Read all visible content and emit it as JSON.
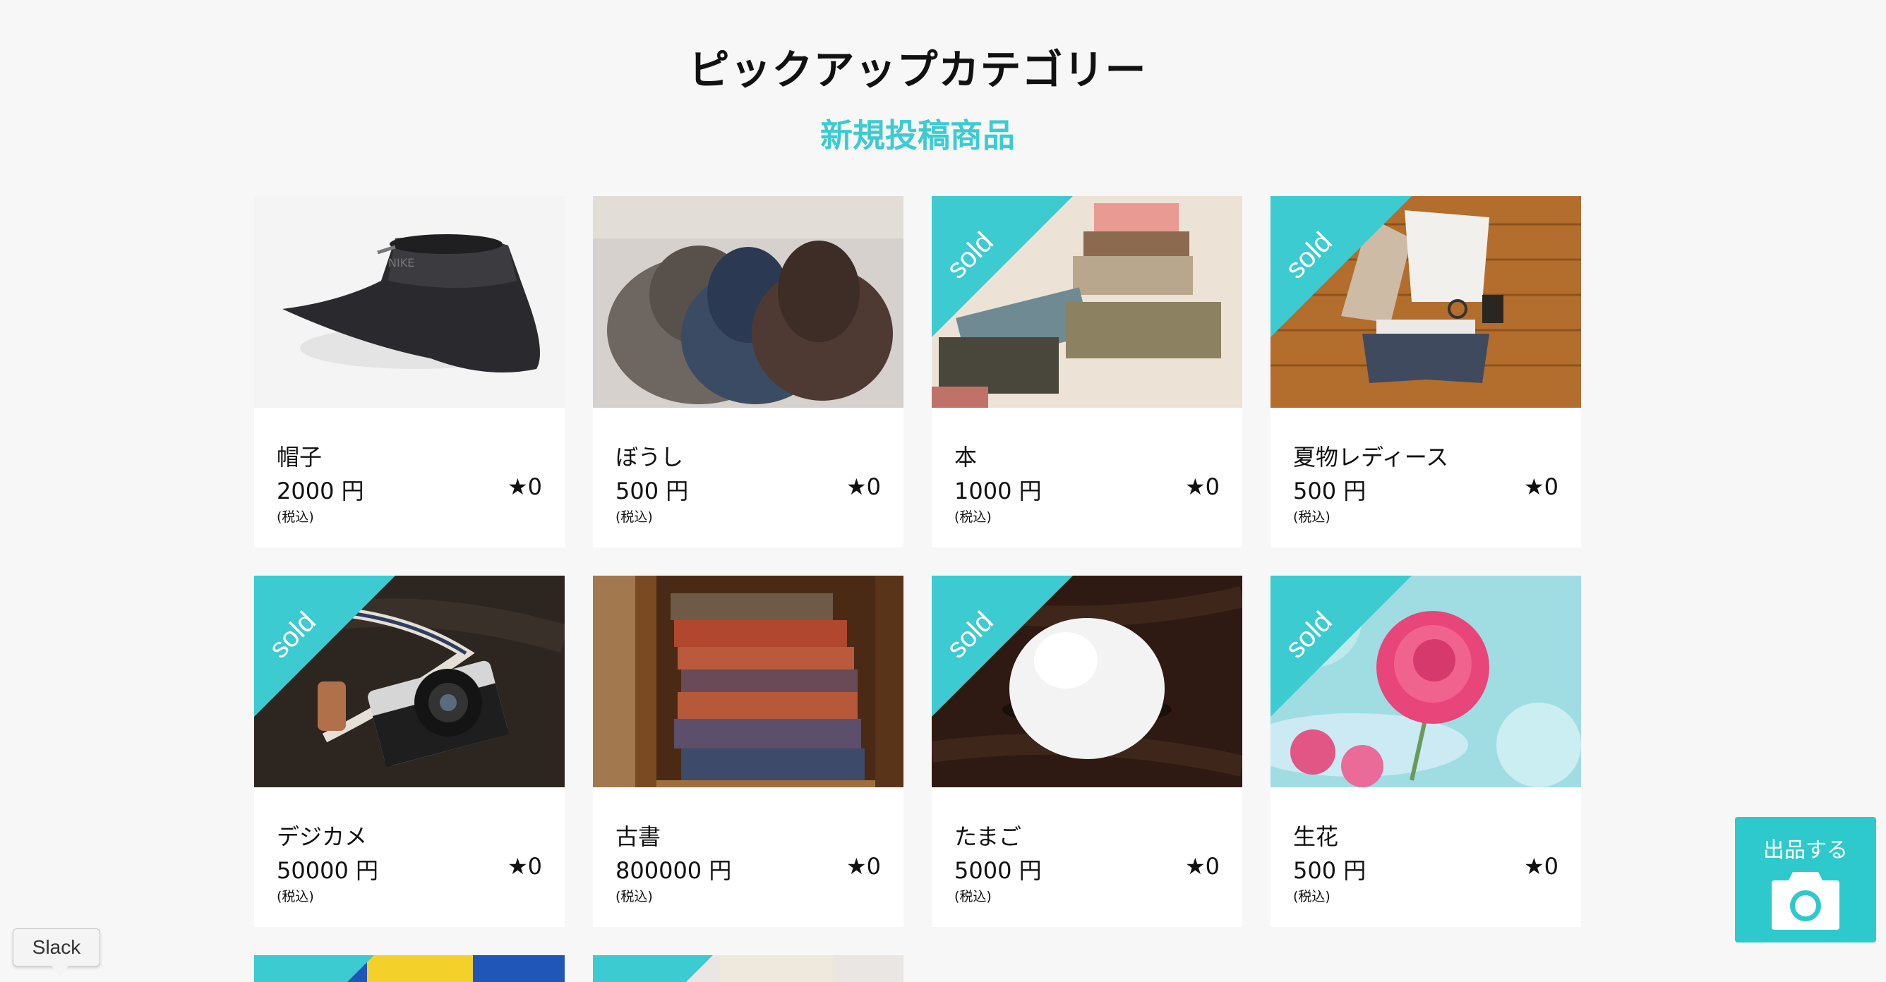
{
  "header": {
    "title": "ピックアップカテゴリー",
    "section_title": "新規投稿商品"
  },
  "products": [
    {
      "name": "帽子",
      "price": "2000 円",
      "tax": "(税込)",
      "likes": "★0",
      "sold": false,
      "image": "black-bucket-hat"
    },
    {
      "name": "ぼうし",
      "price": "500 円",
      "tax": "(税込)",
      "likes": "★0",
      "sold": false,
      "image": "stacked-fedora-hats"
    },
    {
      "name": "本",
      "price": "1000 円",
      "tax": "(税込)",
      "likes": "★0",
      "sold": true,
      "image": "antique-books-pile"
    },
    {
      "name": "夏物レディース",
      "price": "500 円",
      "tax": "(税込)",
      "likes": "★0",
      "sold": true,
      "image": "summer-outfit-on-wood"
    },
    {
      "name": "デジカメ",
      "price": "50000 円",
      "tax": "(税込)",
      "likes": "★0",
      "sold": true,
      "image": "film-camera-with-strap"
    },
    {
      "name": "古書",
      "price": "800000 円",
      "tax": "(税込)",
      "likes": "★0",
      "sold": false,
      "image": "old-book-stack"
    },
    {
      "name": "たまご",
      "price": "5000 円",
      "tax": "(税込)",
      "likes": "★0",
      "sold": true,
      "image": "white-egg-on-wood"
    },
    {
      "name": "生花",
      "price": "500 円",
      "tax": "(税込)",
      "likes": "★0",
      "sold": true,
      "image": "pink-ranunculus-flower"
    }
  ],
  "sold_label": "sold",
  "sell_button": {
    "label": "出品する",
    "icon": "camera-icon"
  },
  "tooltip": {
    "label": "Slack"
  },
  "colors": {
    "accent": "#3ccbd0",
    "sell_button": "#2ec9cc",
    "background": "#f7f7f7"
  }
}
